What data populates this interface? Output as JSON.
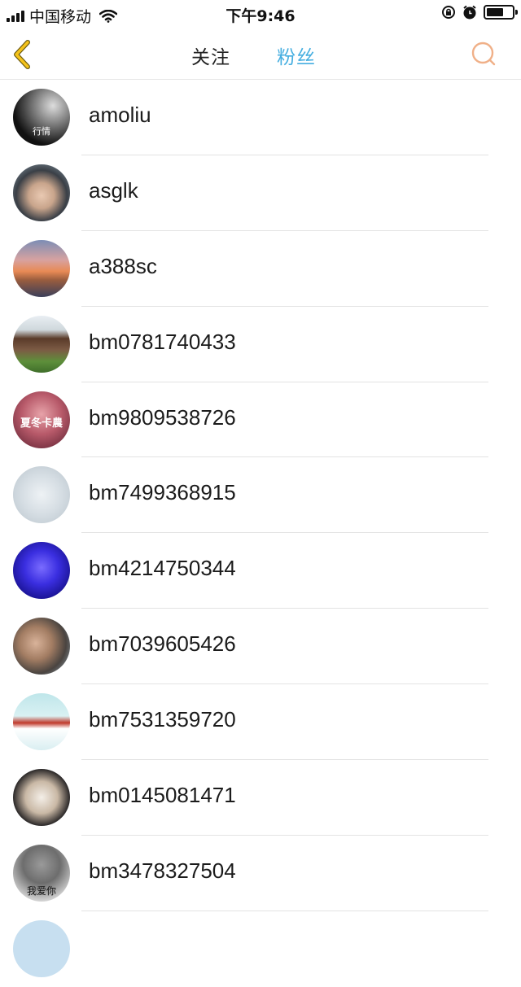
{
  "status_bar": {
    "carrier": "中国移动",
    "time": "下午9:46"
  },
  "nav": {
    "tab_follow": "关注",
    "tab_fans": "粉丝",
    "active_color": "#45aee0",
    "back_icon": "chevron-left-icon",
    "search_icon": "search-icon"
  },
  "fans": [
    {
      "username": "amoliu",
      "avatar_text": "行情"
    },
    {
      "username": "asglk",
      "avatar_text": ""
    },
    {
      "username": "a388sc",
      "avatar_text": ""
    },
    {
      "username": "bm0781740433",
      "avatar_text": ""
    },
    {
      "username": "bm9809538726",
      "avatar_text": "夏冬卡農"
    },
    {
      "username": "bm7499368915",
      "avatar_text": ""
    },
    {
      "username": "bm4214750344",
      "avatar_text": ""
    },
    {
      "username": "bm7039605426",
      "avatar_text": ""
    },
    {
      "username": "bm7531359720",
      "avatar_text": ""
    },
    {
      "username": "bm0145081471",
      "avatar_text": ""
    },
    {
      "username": "bm3478327504",
      "avatar_text": "我爱你"
    }
  ]
}
